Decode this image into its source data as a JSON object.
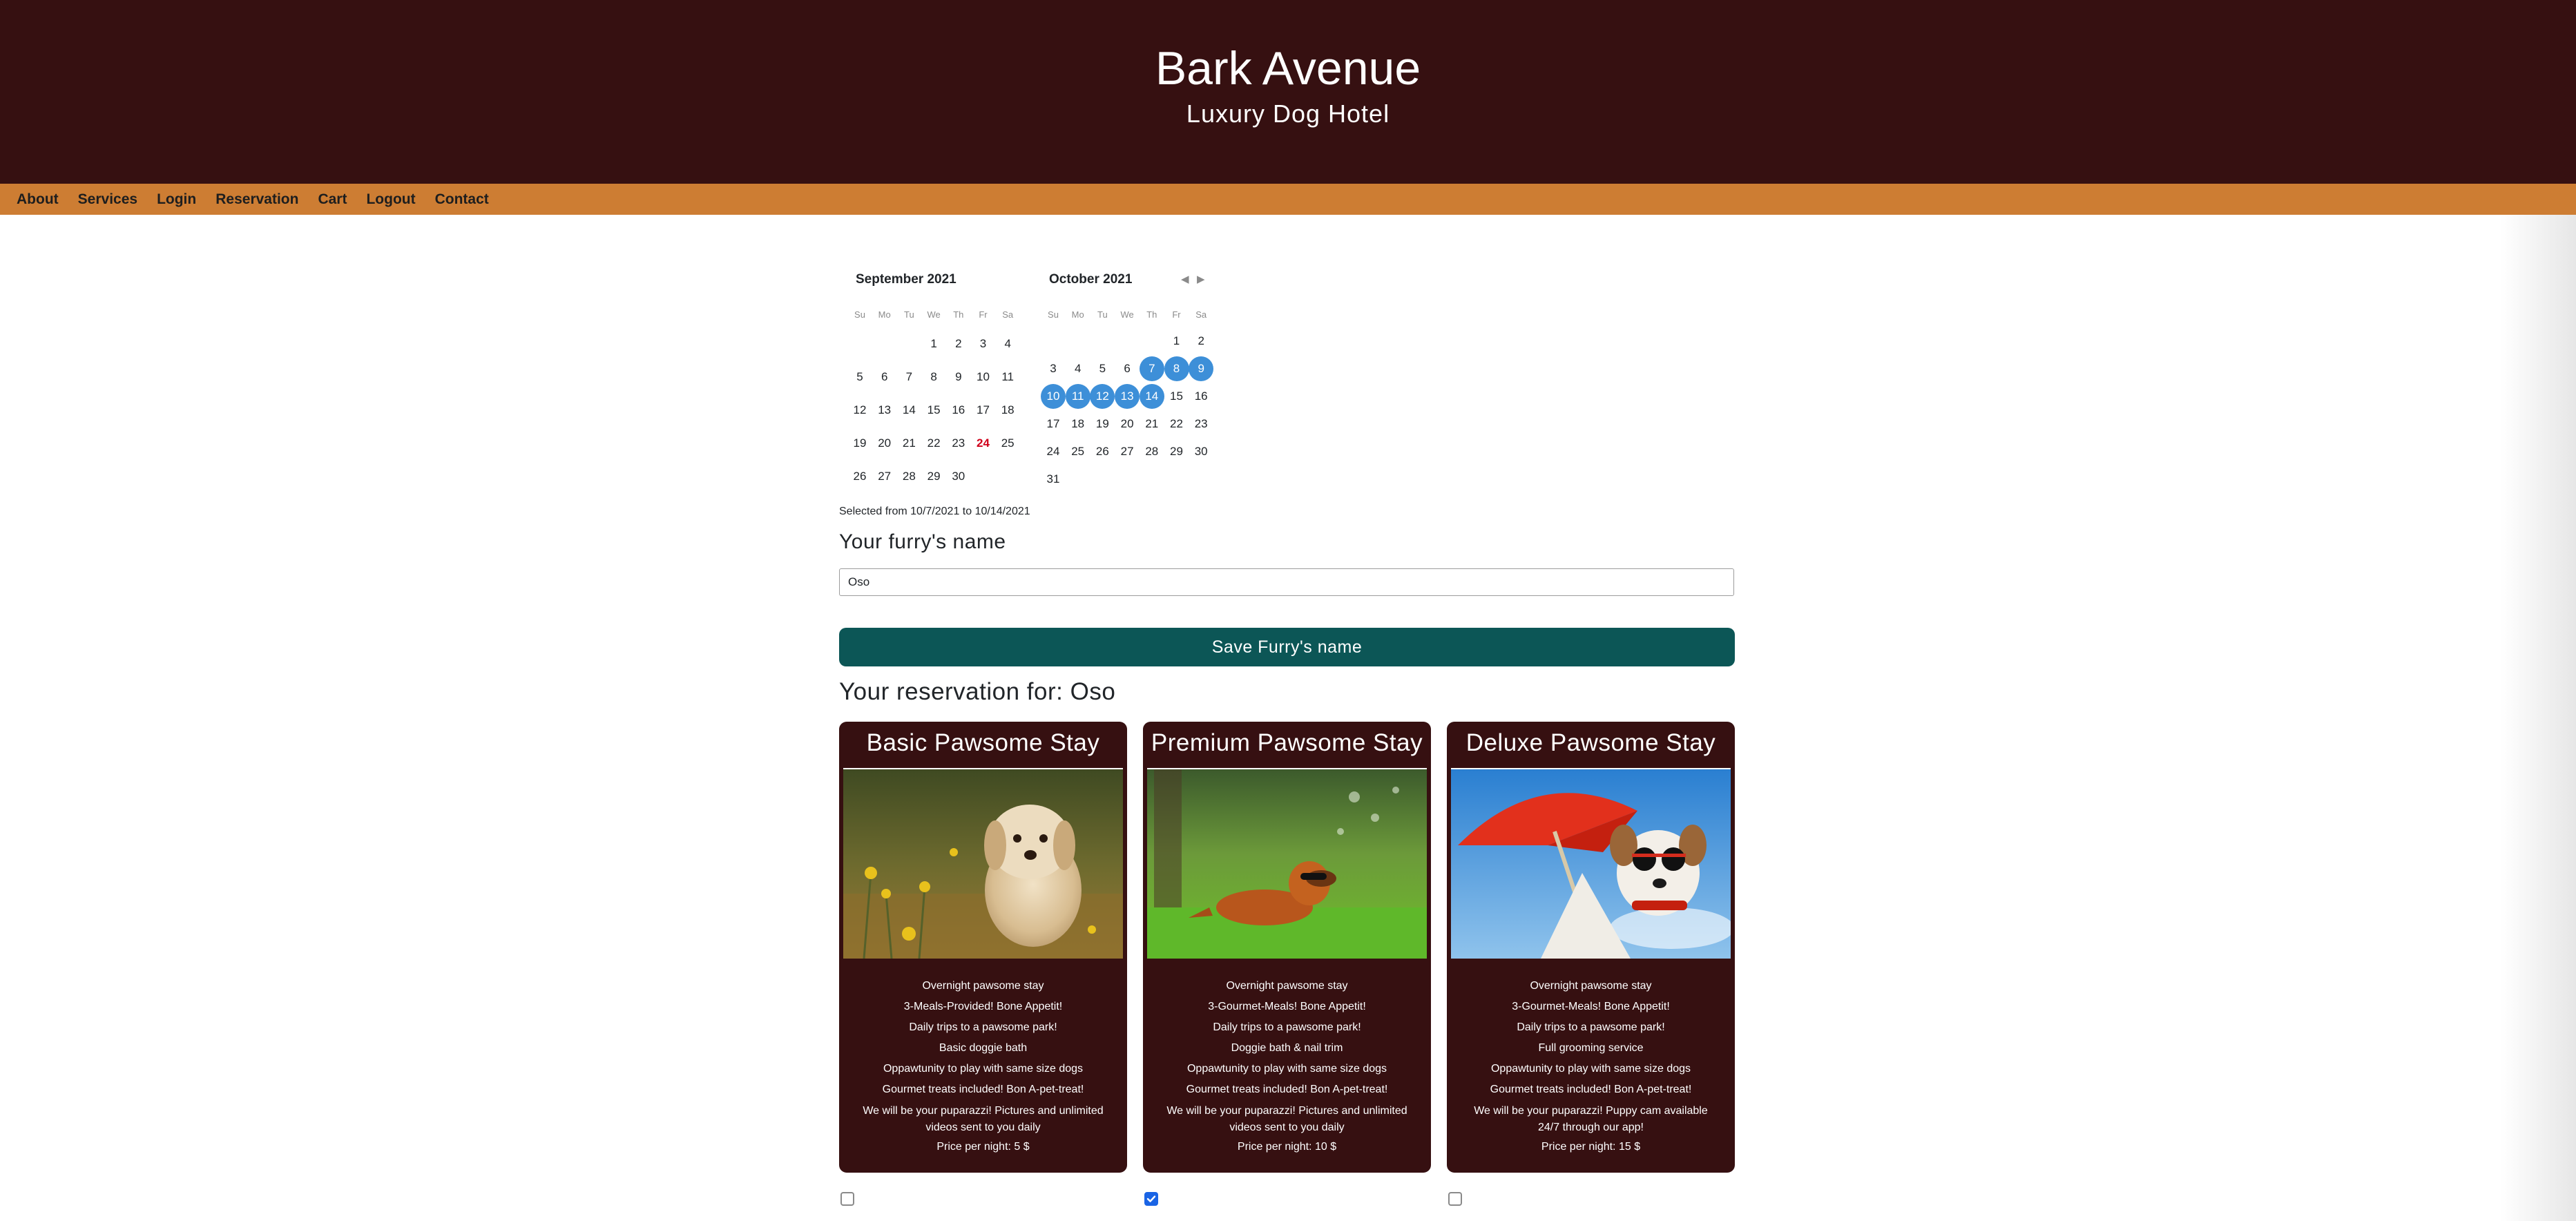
{
  "header": {
    "title": "Bark Avenue",
    "subtitle": "Luxury Dog Hotel"
  },
  "nav": [
    "About",
    "Services",
    "Login",
    "Reservation",
    "Cart",
    "Logout",
    "Contact"
  ],
  "calendar": {
    "weekdays": [
      "Su",
      "Mo",
      "Tu",
      "We",
      "Th",
      "Fr",
      "Sa"
    ],
    "months": [
      {
        "title": "September 2021",
        "rows": [
          [
            "",
            "",
            "",
            "1",
            "2",
            "3",
            "4"
          ],
          [
            "5",
            "6",
            "7",
            "8",
            "9",
            "10",
            "11"
          ],
          [
            "12",
            "13",
            "14",
            "15",
            "16",
            "17",
            "18"
          ],
          [
            "19",
            "20",
            "21",
            "22",
            "23",
            "24",
            "25"
          ],
          [
            "26",
            "27",
            "28",
            "29",
            "30",
            "",
            ""
          ]
        ],
        "today": "24",
        "selected": []
      },
      {
        "title": "October 2021",
        "rows": [
          [
            "",
            "",
            "",
            "",
            "",
            "1",
            "2"
          ],
          [
            "3",
            "4",
            "5",
            "6",
            "7",
            "8",
            "9"
          ],
          [
            "10",
            "11",
            "12",
            "13",
            "14",
            "15",
            "16"
          ],
          [
            "17",
            "18",
            "19",
            "20",
            "21",
            "22",
            "23"
          ],
          [
            "24",
            "25",
            "26",
            "27",
            "28",
            "29",
            "30"
          ],
          [
            "31",
            "",
            "",
            "",
            "",
            "",
            ""
          ]
        ],
        "today": "",
        "selected": [
          "7",
          "8",
          "9",
          "10",
          "11",
          "12",
          "13",
          "14"
        ]
      }
    ],
    "prev_icon": "triangle-left-icon",
    "next_icon": "triangle-right-icon",
    "selected_color": "#3d8fd8",
    "today_color": "#d0021b"
  },
  "selection_text": "Selected from 10/7/2021 to 10/14/2021",
  "name_form": {
    "label": "Your furry's name",
    "value": "Oso",
    "button": "Save Furry's name"
  },
  "reservation": {
    "prefix": "Your reservation for:",
    "name": "Oso"
  },
  "packages": [
    {
      "title": "Basic Pawsome Stay",
      "image": "fluffy-puppy-in-dandelion-field-image",
      "features": [
        "Overnight pawsome stay",
        "3-Meals-Provided! Bone Appetit!",
        "Daily trips to a pawsome park!",
        "Basic doggie bath",
        "Oppawtunity to play with same size dogs",
        "Gourmet treats included! Bon A-pet-treat!",
        "We will be your puparazzi! Pictures and unlimited videos sent to you daily"
      ],
      "price": "Price per night: 5 $",
      "checked": false
    },
    {
      "title": "Premium Pawsome Stay",
      "image": "dog-with-sunglasses-on-grass-image",
      "features": [
        "Overnight pawsome stay",
        "3-Gourmet-Meals! Bone Appetit!",
        "Daily trips to a pawsome park!",
        "Doggie bath & nail trim",
        "Oppawtunity to play with same size dogs",
        "Gourmet treats included! Bon A-pet-treat!",
        "We will be your puparazzi! Pictures and unlimited videos sent to you daily"
      ],
      "price": "Price per night: 10 $",
      "checked": true
    },
    {
      "title": "Deluxe Pawsome Stay",
      "image": "dog-with-sunglasses-under-red-umbrella-image",
      "features": [
        "Overnight pawsome stay",
        "3-Gourmet-Meals! Bone Appetit!",
        "Daily trips to a pawsome park!",
        "Full grooming service",
        "Oppawtunity to play with same size dogs",
        "Gourmet treats included! Bon A-pet-treat!",
        "We will be your puparazzi! Puppy cam available 24/7 through our app!"
      ],
      "price": "Price per night: 15 $",
      "checked": false
    }
  ],
  "colors": {
    "header_bg": "#361011",
    "nav_bg": "#cd7d33",
    "button_bg": "#0c5656",
    "card_bg": "#361011",
    "checkbox_checked": "#1a64e5"
  }
}
